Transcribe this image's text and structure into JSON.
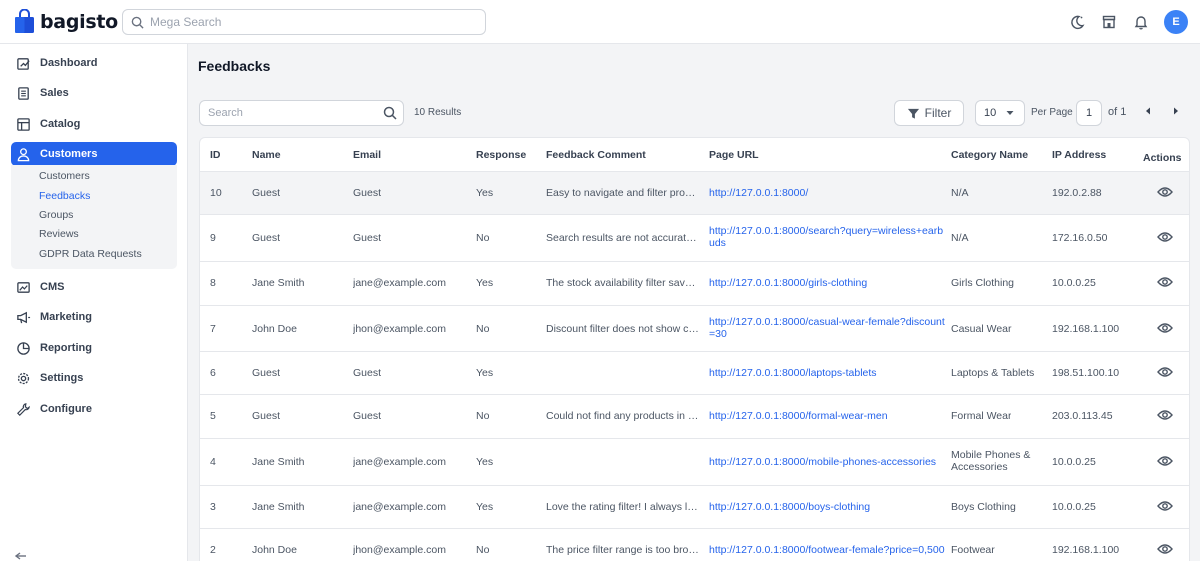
{
  "app": {
    "name": "bagisto",
    "user_initial": "E"
  },
  "search": {
    "placeholder": "Mega Search"
  },
  "sidebar": {
    "items": [
      {
        "label": "Dashboard",
        "icon": "dashboard-icon"
      },
      {
        "label": "Sales",
        "icon": "sales-icon"
      },
      {
        "label": "Catalog",
        "icon": "catalog-icon"
      },
      {
        "label": "Customers",
        "icon": "customers-icon"
      },
      {
        "label": "CMS",
        "icon": "cms-icon"
      },
      {
        "label": "Marketing",
        "icon": "marketing-icon"
      },
      {
        "label": "Reporting",
        "icon": "reporting-icon"
      },
      {
        "label": "Settings",
        "icon": "settings-icon"
      },
      {
        "label": "Configure",
        "icon": "configure-icon"
      }
    ],
    "sub_items": [
      {
        "label": "Customers"
      },
      {
        "label": "Feedbacks"
      },
      {
        "label": "Groups"
      },
      {
        "label": "Reviews"
      },
      {
        "label": "GDPR Data Requests"
      }
    ]
  },
  "page": {
    "title": "Feedbacks",
    "search_placeholder": "Search",
    "results": "10 Results",
    "filter_label": "Filter",
    "per_page_value": "10",
    "per_page_label": "Per Page",
    "current_page": "1",
    "of_label": "of 1"
  },
  "table": {
    "headers": [
      "ID",
      "Name",
      "Email",
      "Response",
      "Feedback Comment",
      "Page URL",
      "Category Name",
      "IP Address",
      "Actions"
    ],
    "rows": [
      {
        "id": "10",
        "name": "Guest",
        "email": "Guest",
        "response": "Yes",
        "comment": "Easy to navigate and filter products quickly.",
        "url": "http://127.0.0.1:8000/",
        "category": "N/A",
        "ip": "192.0.2.88"
      },
      {
        "id": "9",
        "name": "Guest",
        "email": "Guest",
        "response": "No",
        "comment": "Search results are not accurate. Showing unrelated products.",
        "url": "http://127.0.0.1:8000/search?query=wireless+earbuds",
        "category": "N/A",
        "ip": "172.16.0.50"
      },
      {
        "id": "8",
        "name": "Jane Smith",
        "email": "jane@example.com",
        "response": "Yes",
        "comment": "The stock availability filter saved me time.",
        "url": "http://127.0.0.1:8000/girls-clothing",
        "category": "Girls Clothing",
        "ip": "10.0.0.25"
      },
      {
        "id": "7",
        "name": "John Doe",
        "email": "jhon@example.com",
        "response": "No",
        "comment": "Discount filter does not show correct results.",
        "url": "http://127.0.0.1:8000/casual-wear-female?discount=30",
        "category": "Casual Wear",
        "ip": "192.168.1.100"
      },
      {
        "id": "6",
        "name": "Guest",
        "email": "Guest",
        "response": "Yes",
        "comment": "",
        "url": "http://127.0.0.1:8000/laptops-tablets",
        "category": "Laptops & Tablets",
        "ip": "198.51.100.10"
      },
      {
        "id": "5",
        "name": "Guest",
        "email": "Guest",
        "response": "No",
        "comment": "Could not find any products in my size.",
        "url": "http://127.0.0.1:8000/formal-wear-men",
        "category": "Formal Wear",
        "ip": "203.0.113.45"
      },
      {
        "id": "4",
        "name": "Jane Smith",
        "email": "jane@example.com",
        "response": "Yes",
        "comment": "",
        "url": "http://127.0.0.1:8000/mobile-phones-accessories",
        "category": "Mobile Phones & Accessories",
        "ip": "10.0.0.25"
      },
      {
        "id": "3",
        "name": "Jane Smith",
        "email": "jane@example.com",
        "response": "Yes",
        "comment": "Love the rating filter! I always look for top rated items.",
        "url": "http://127.0.0.1:8000/boys-clothing",
        "category": "Boys Clothing",
        "ip": "10.0.0.25"
      },
      {
        "id": "2",
        "name": "John Doe",
        "email": "jhon@example.com",
        "response": "No",
        "comment": "The price filter range is too broad for budget shopping.",
        "url": "http://127.0.0.1:8000/footwear-female?price=0,500",
        "category": "Footwear",
        "ip": "192.168.1.100"
      }
    ]
  },
  "colors": {
    "accent": "#2563eb",
    "link": "#2563eb",
    "highlight_row": "#f3f4f6"
  }
}
